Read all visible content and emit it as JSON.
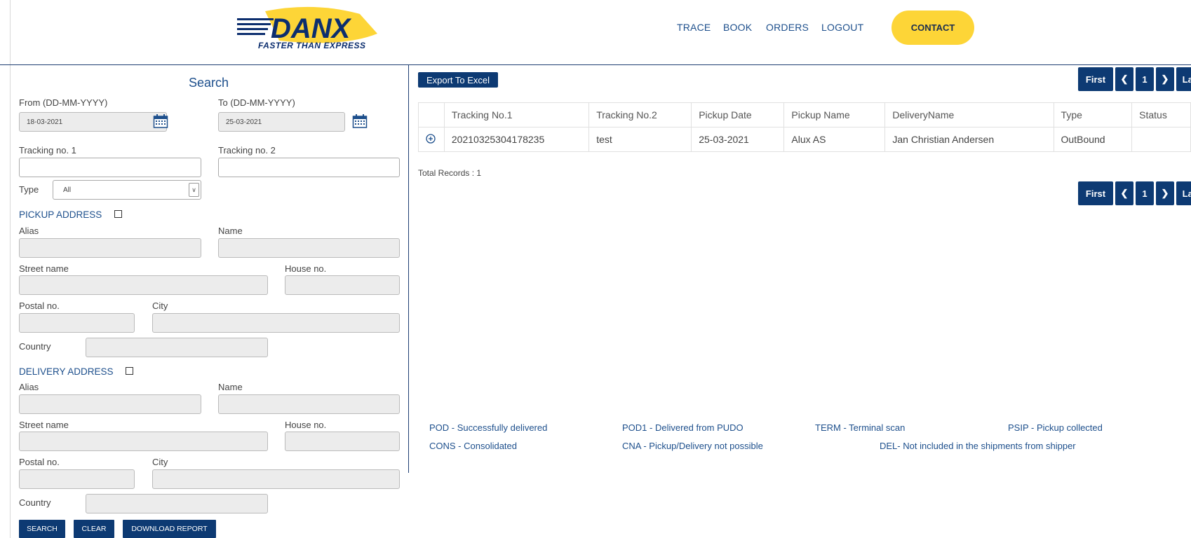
{
  "header": {
    "logo_text": "DANX",
    "logo_tagline": "FASTER THAN EXPRESS",
    "nav": [
      "TRACE",
      "BOOK",
      "ORDERS",
      "LOGOUT"
    ],
    "contact_label": "CONTACT"
  },
  "colors": {
    "brand_blue": "#0d3a73",
    "accent_yellow": "#fdd537"
  },
  "search": {
    "title": "Search",
    "from_label": "From (DD-MM-YYYY)",
    "from_value": "18-03-2021",
    "to_label": "To (DD-MM-YYYY)",
    "to_value": "25-03-2021",
    "tracking1_label": "Tracking no. 1",
    "tracking2_label": "Tracking no. 2",
    "type_label": "Type",
    "type_value": "All",
    "pickup": {
      "heading": "PICKUP ADDRESS",
      "alias_label": "Alias",
      "name_label": "Name",
      "street_label": "Street name",
      "house_label": "House no.",
      "postal_label": "Postal no.",
      "city_label": "City",
      "country_label": "Country"
    },
    "delivery": {
      "heading": "DELIVERY ADDRESS",
      "alias_label": "Alias",
      "name_label": "Name",
      "street_label": "Street name",
      "house_label": "House no.",
      "postal_label": "Postal no.",
      "city_label": "City",
      "country_label": "Country"
    },
    "buttons": {
      "search": "SEARCH",
      "clear": "CLEAR",
      "download": "DOWNLOAD REPORT"
    }
  },
  "results": {
    "export_label": "Export To Excel",
    "pager": {
      "first": "First",
      "page": "1",
      "last": "Last"
    },
    "columns": [
      "Tracking No.1",
      "Tracking No.2",
      "Pickup Date",
      "Pickup Name",
      "DeliveryName",
      "Type",
      "Status"
    ],
    "rows": [
      [
        "20210325304178235",
        "test",
        "25-03-2021",
        "Alux AS",
        "Jan Christian Andersen",
        "OutBound",
        ""
      ]
    ],
    "total_records": "Total Records : 1"
  },
  "legend": [
    "POD - Successfully delivered",
    "POD1 - Delivered from PUDO",
    "TERM - Terminal scan",
    "PSIP - Pickup collected",
    "CONS - Consolidated",
    "CNA - Pickup/Delivery not possible",
    "DEL- Not included in the shipments from shipper"
  ]
}
